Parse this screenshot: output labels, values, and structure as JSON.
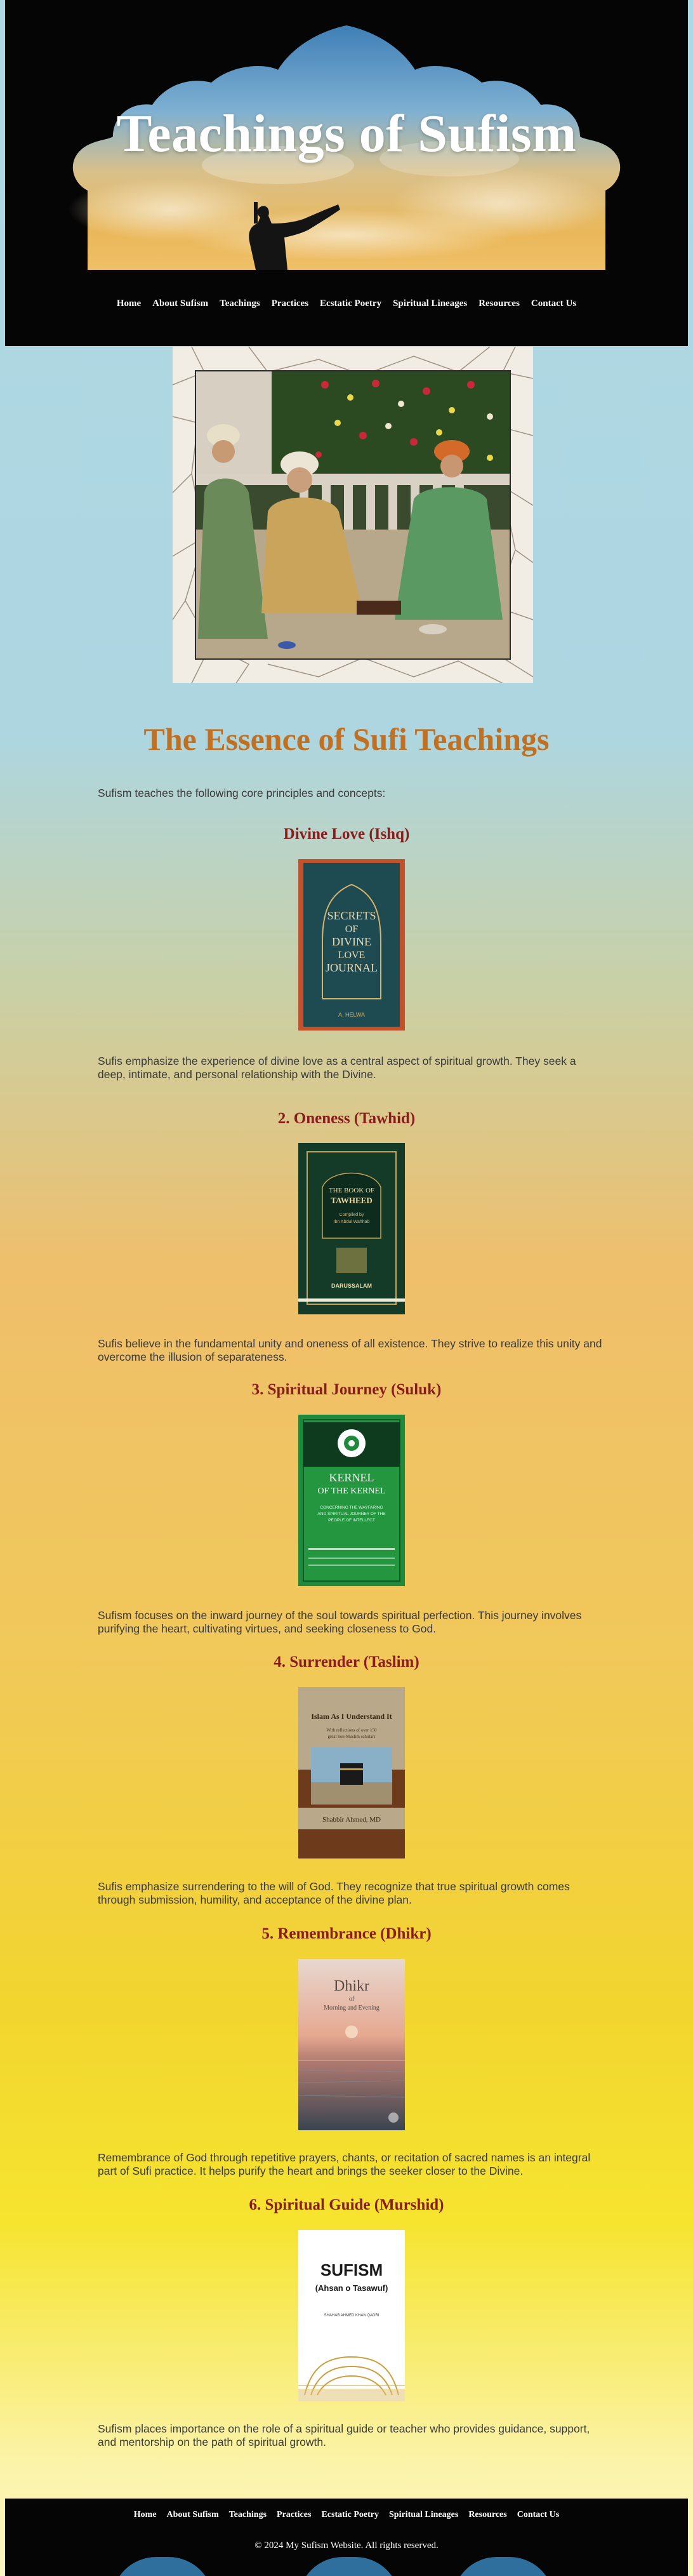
{
  "header": {
    "site_title": "Teachings of Sufism",
    "nav": [
      "Home",
      "About Sufism",
      "Teachings",
      "Practices",
      "Ecstatic Poetry",
      "Spiritual Lineages",
      "Resources",
      "Contact Us"
    ]
  },
  "main": {
    "title": "The Essence of Sufi Teachings",
    "intro": "Sufism teaches the following core principles and concepts:",
    "sections": [
      {
        "heading": "Divine Love (Ishq)",
        "text": "Sufis emphasize the experience of divine love as a central aspect of spiritual growth. They seek a deep, intimate, and personal relationship with the Divine.",
        "book": {
          "line1": "SECRETS",
          "line2": "OF",
          "line3": "DIVINE",
          "line4": "LOVE",
          "line5": "JOURNAL",
          "author": "A. HELWA",
          "color": "#1e4a52",
          "border": "#c0532c"
        }
      },
      {
        "heading": "2. Oneness (Tawhid)",
        "text": "Sufis believe in the fundamental unity and oneness of all existence. They strive to realize this unity and overcome the illusion of separateness.",
        "book": {
          "line1": "THE BOOK OF",
          "line2": "TAWHEED",
          "line3": "Compiled by",
          "line4": "Ibn Abdul Wahhab",
          "line5": "DARUSSALAM",
          "color": "#143a28"
        }
      },
      {
        "heading": "3. Spiritual Journey (Suluk)",
        "text": "Sufism focuses on the inward journey of the soul towards spiritual perfection. This journey involves purifying the heart, cultivating virtues, and seeking closeness to God.",
        "book": {
          "line1": "KERNEL",
          "line2": "OF THE KERNEL",
          "line3": "CONCERNING THE WAYFARING",
          "line4": "AND SPIRITUAL JOURNEY OF THE",
          "line5": "PEOPLE OF INTELLECT",
          "color": "#1f8a3c"
        }
      },
      {
        "heading": "4. Surrender (Taslim)",
        "text": "Sufis emphasize surrendering to the will of God. They recognize that true spiritual growth comes through submission, humility, and acceptance of the divine plan.",
        "book": {
          "line1": "Islam As I Understand It",
          "line2": "With reflections of over 150",
          "line3": "great non-Muslim scholars",
          "author": "Shabbir Ahmed, MD",
          "color": "#6e3a1c"
        }
      },
      {
        "heading": "5. Remembrance (Dhikr)",
        "text": "Remembrance of God through repetitive prayers, chants, or recitation of sacred names is an integral part of Sufi practice. It helps purify the heart and brings the seeker closer to the Divine.",
        "book": {
          "line1": "Dhikr",
          "line2": "of",
          "line3": "Morning and Evening",
          "color": "#5a6a78"
        }
      },
      {
        "heading": "6. Spiritual Guide (Murshid)",
        "text": "Sufism places importance on the role of a spiritual guide or teacher who provides guidance, support, and mentorship on the path of spiritual growth.",
        "book": {
          "line1": "SUFISM",
          "line2": "(Ahsan o Tasawuf)",
          "line3": "SHAHAB AHMED KHAN QADRI",
          "color": "#ffffff"
        }
      }
    ]
  },
  "footer": {
    "nav": [
      "Home",
      "About Sufism",
      "Teachings",
      "Practices",
      "Ecstatic Poetry",
      "Spiritual Lineages",
      "Resources",
      "Contact Us"
    ],
    "copyright": "© 2024 My Sufism Website. All rights reserved."
  }
}
